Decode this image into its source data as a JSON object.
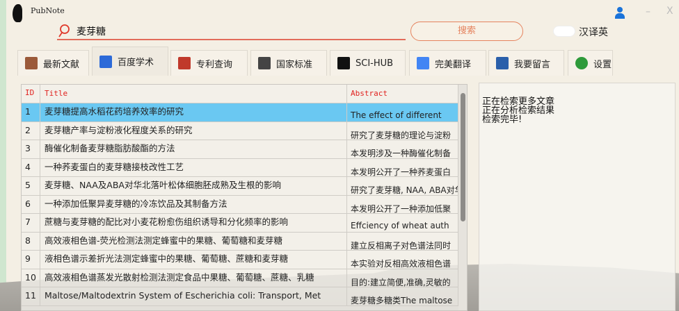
{
  "app": {
    "title": "PubNote"
  },
  "search": {
    "value": "麦芽糖",
    "button": "搜索",
    "toggle_label": "汉译英"
  },
  "window": {
    "minimize": "–",
    "close": "X"
  },
  "tabs": [
    {
      "label": "最新文献",
      "icon": "literature-icon",
      "color": "#9b5a3a"
    },
    {
      "label": "百度学术",
      "icon": "baidu-paw-icon",
      "color": "#2d6ad8"
    },
    {
      "label": "专利查询",
      "icon": "patent-icon",
      "color": "#c0392b"
    },
    {
      "label": "国家标准",
      "icon": "gb-standard-icon",
      "color": "#444444"
    },
    {
      "label": "SCI-HUB",
      "icon": "sci-hub-raven-icon",
      "color": "#111111"
    },
    {
      "label": "完美翻译",
      "icon": "google-translate-icon",
      "color": "#4285f4"
    },
    {
      "label": "我要留言",
      "icon": "message-icon",
      "color": "#2a5faa"
    },
    {
      "label": "设置",
      "icon": "gear-icon",
      "color": "#2e9a3a"
    }
  ],
  "table": {
    "headers": [
      "ID",
      "Title",
      "Abstract"
    ],
    "rows": [
      {
        "id": "1",
        "title": "麦芽糖提高水稻花药培养效率的研究",
        "abstract": "The effect of different"
      },
      {
        "id": "2",
        "title": "麦芽糖产率与淀粉液化程度关系的研究",
        "abstract": "研究了麦芽糖的理论与淀粉"
      },
      {
        "id": "3",
        "title": "酶催化制备麦芽糖脂肪酸酯的方法",
        "abstract": "本发明涉及一种酶催化制备"
      },
      {
        "id": "4",
        "title": "一种荞麦蛋白的麦芽糖接枝改性工艺",
        "abstract": "本发明公开了一种荞麦蛋白"
      },
      {
        "id": "5",
        "title": "麦芽糖、NAA及ABA对华北落叶松体细胞胚成熟及生根的影响",
        "abstract": "研究了麦芽糖, NAA, ABA对华"
      },
      {
        "id": "6",
        "title": "一种添加低聚异麦芽糖的冷冻饮品及其制备方法",
        "abstract": "本发明公开了一种添加低聚"
      },
      {
        "id": "7",
        "title": "蔗糖与麦芽糖的配比对小麦花粉愈伤组织诱导和分化频率的影响",
        "abstract": "Effciency of wheat auth"
      },
      {
        "id": "8",
        "title": "高效液相色谱-荧光检测法测定蜂蜜中的果糖、葡萄糖和麦芽糖",
        "abstract": "建立反相离子对色谱法同时"
      },
      {
        "id": "9",
        "title": "液相色谱示差折光法测定蜂蜜中的果糖、葡萄糖、蔗糖和麦芽糖",
        "abstract": "本实验对反相高效液相色谱"
      },
      {
        "id": "10",
        "title": "高效液相色谱蒸发光散射检测法测定食品中果糖、葡萄糖、蔗糖、乳糖",
        "abstract": "目的:建立简便,准确,灵敏的"
      },
      {
        "id": "11",
        "title": "Maltose/Maltodextrin System of Escherichia coli: Transport, Met",
        "abstract": "麦芽糖多糖类The maltose"
      }
    ]
  },
  "log": {
    "lines": [
      "正在检索更多文章",
      "正在分析检索结果",
      "检索完毕!"
    ]
  }
}
